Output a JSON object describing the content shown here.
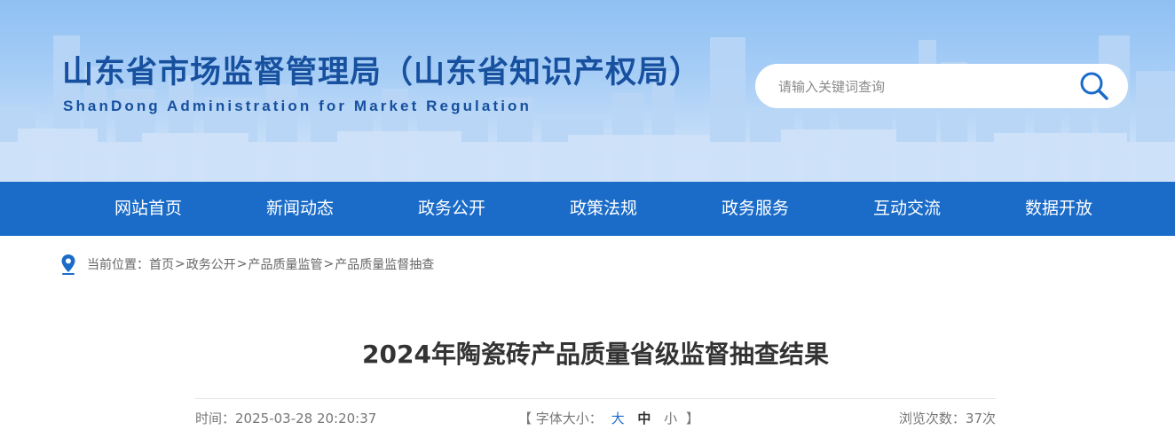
{
  "header": {
    "title": "山东省市场监督管理局（山东省知识产权局）",
    "subtitle": "ShanDong Administration for Market Regulation"
  },
  "search": {
    "placeholder": "请输入关键词查询",
    "value": "",
    "icon": "search-icon"
  },
  "nav": {
    "items": [
      {
        "label": "网站首页"
      },
      {
        "label": "新闻动态"
      },
      {
        "label": "政务公开"
      },
      {
        "label": "政策法规"
      },
      {
        "label": "政务服务"
      },
      {
        "label": "互动交流"
      },
      {
        "label": "数据开放"
      }
    ]
  },
  "breadcrumb": {
    "icon": "location-pin-icon",
    "prefix": "当前位置：",
    "items": [
      "首页",
      "政务公开",
      "产品质量监管",
      "产品质量监督抽查"
    ],
    "separator": ">"
  },
  "article": {
    "title": "2024年陶瓷砖产品质量省级监督抽查结果",
    "time_label": "时间：",
    "time": "2025-03-28 20:20:37",
    "font_size_open": "【 字体大小：",
    "font_sizes": [
      "大",
      "中",
      "小"
    ],
    "font_size_close": "】",
    "views_label": "浏览次数：",
    "views": "37次"
  },
  "colors": {
    "brand_blue": "#1b6cc9",
    "title_blue": "#17509e",
    "text_gray": "#777777"
  }
}
